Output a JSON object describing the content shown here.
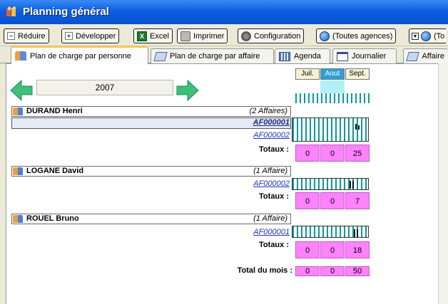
{
  "window": {
    "title": "Planning général"
  },
  "toolbar": {
    "reduce": "Réduire",
    "expand": "Développer",
    "excel": "Excel",
    "print": "Imprimer",
    "config": "Configuration",
    "agencies": "(Toutes agences)",
    "more": "(To"
  },
  "tabs": [
    "Plan de charge par personne",
    "Plan de charge par affaire",
    "Agenda",
    "Journalier",
    "Affaire"
  ],
  "year": "2007",
  "months": [
    "Juil.",
    "Aout",
    "Sept."
  ],
  "selected_month": "Aout",
  "persons": [
    {
      "name": "DURAND Henri",
      "count": "(2 Affaires)",
      "affairs": [
        "AF000001",
        "AF000002"
      ],
      "totals_label": "Totaux :",
      "totals": [
        "0",
        "0",
        "25"
      ]
    },
    {
      "name": "LOGANE David",
      "count": "(1 Affaire)",
      "affairs": [
        "AF000002"
      ],
      "totals_label": "Totaux :",
      "totals": [
        "0",
        "0",
        "7"
      ]
    },
    {
      "name": "ROUEL Bruno",
      "count": "(1 Affaire)",
      "affairs": [
        "AF000001"
      ],
      "totals_label": "Totaux :",
      "totals": [
        "0",
        "0",
        "18"
      ]
    }
  ],
  "month_total": {
    "label": "Total du mois :",
    "values": [
      "0",
      "0",
      "50"
    ]
  },
  "colors": {
    "title_bar": "#0a5fe0",
    "hatch": "#0f9a9a",
    "total_cell": "#ff82ff",
    "selected_month": "#2d9fd8"
  }
}
